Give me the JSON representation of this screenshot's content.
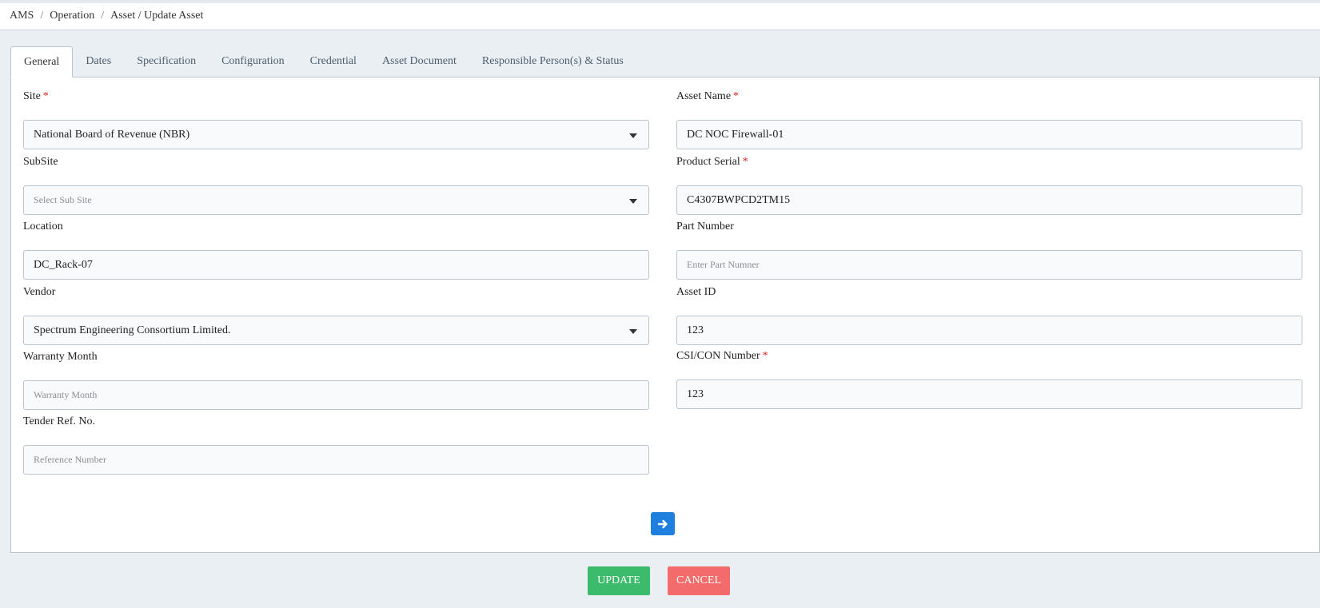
{
  "breadcrumb": {
    "items": [
      "AMS",
      "Operation",
      "Asset / Update Asset"
    ],
    "separator": "/"
  },
  "tabs": [
    {
      "label": "General",
      "active": true
    },
    {
      "label": "Dates"
    },
    {
      "label": "Specification"
    },
    {
      "label": "Configuration"
    },
    {
      "label": "Credential"
    },
    {
      "label": "Asset Document"
    },
    {
      "label": "Responsible Person(s) & Status"
    }
  ],
  "form": {
    "required_marker": "*",
    "site": {
      "label": "Site",
      "value": "National Board of Revenue (NBR)"
    },
    "subsite": {
      "label": "SubSite",
      "placeholder": "Select Sub Site"
    },
    "location": {
      "label": "Location",
      "value": "DC_Rack-07"
    },
    "vendor": {
      "label": "Vendor",
      "value": "Spectrum Engineering Consortium Limited."
    },
    "warranty_month": {
      "label": "Warranty Month",
      "placeholder": "Warranty Month"
    },
    "tender_ref": {
      "label": "Tender Ref. No.",
      "placeholder": "Reference Number"
    },
    "asset_name": {
      "label": "Asset Name",
      "value": "DC NOC Firewall-01"
    },
    "product_serial": {
      "label": "Product Serial",
      "value": "C4307BWPCD2TM15"
    },
    "part_number": {
      "label": "Part Number",
      "placeholder": "Enter Part Numner"
    },
    "asset_id": {
      "label": "Asset ID",
      "value": "123"
    },
    "csi_con_number": {
      "label": "CSI/CON Number",
      "value": "123"
    }
  },
  "buttons": {
    "next_icon": "arrow-right-icon",
    "update": "UPDATE",
    "cancel": "CANCEL"
  },
  "colors": {
    "primary": "#1e7fde",
    "success": "#3dbb6c",
    "danger": "#f36b6b",
    "required": "#dd2222"
  }
}
